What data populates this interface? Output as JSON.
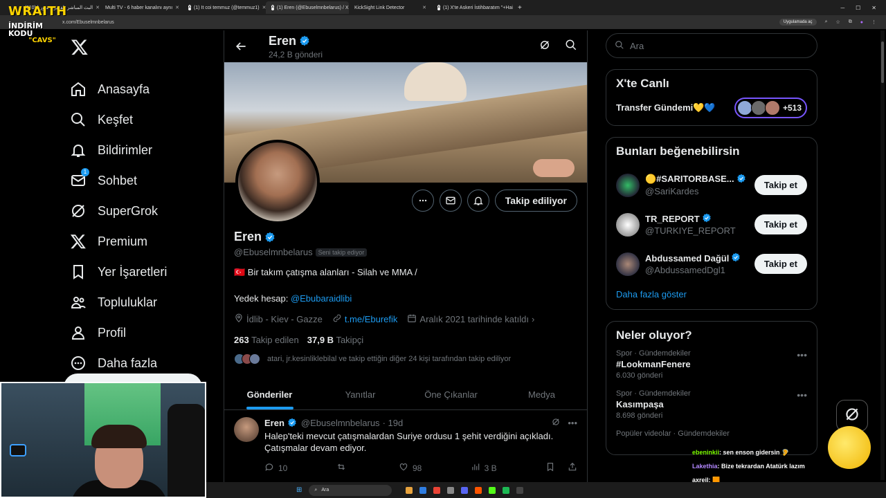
{
  "browser": {
    "tabs": [
      {
        "title": "(110) البث المباشر تلفزيون سوريا",
        "active": false
      },
      {
        "title": "Multi TV - 6 haber kanalını aynı",
        "active": false
      },
      {
        "title": "(1) It coi temmuz (@temmuz1)",
        "active": false
      },
      {
        "title": "(1) Eren (@Ebuselmnbelarus) / X",
        "active": true
      },
      {
        "title": "KickSight Link Detector",
        "active": false
      },
      {
        "title": "(1) X'te Askeri İstihbaratım \"+Hai",
        "active": false
      }
    ],
    "url": "x.com/Ebuselmnbelarus",
    "install_label": "Uygulamada aç"
  },
  "stream_overlay": {
    "line1": "WRAITH",
    "line2": "İNDİRİM KODU",
    "line3": "\"CAVS\""
  },
  "nav": {
    "items": [
      {
        "label": "Anasayfa",
        "icon": "home-icon"
      },
      {
        "label": "Keşfet",
        "icon": "search-icon"
      },
      {
        "label": "Bildirimler",
        "icon": "bell-icon"
      },
      {
        "label": "Sohbet",
        "icon": "mail-icon",
        "badge": "1"
      },
      {
        "label": "SuperGrok",
        "icon": "grok-icon"
      },
      {
        "label": "Premium",
        "icon": "x-icon"
      },
      {
        "label": "Yer İşaretleri",
        "icon": "bookmark-icon"
      },
      {
        "label": "Topluluklar",
        "icon": "communities-icon"
      },
      {
        "label": "Profil",
        "icon": "profile-icon"
      },
      {
        "label": "Daha fazla",
        "icon": "more-icon"
      }
    ]
  },
  "profile": {
    "header_name": "Eren",
    "header_count": "24,2 B gönderi",
    "name": "Eren",
    "handle": "@Ebuselmnbelarus",
    "follows_you": "Seni takip ediyor",
    "bio_line1": "🇹🇷 Bir takım çatışma alanları - Silah ve MMA /",
    "bio_line2_prefix": "Yedek hesap: ",
    "bio_line2_link": "@Ebubaraidlibi",
    "location": "İdlib - Kiev - Gazze",
    "website": "t.me/Eburefik",
    "joined": "Aralık 2021 tarihinde katıldı",
    "following_count": "263",
    "following_label": "Takip edilen",
    "followers_count": "37,9 B",
    "followers_label": "Takipçi",
    "known_followers": "atari, jr.kesinliklebilal ve takip ettiğin diğer 24 kişi tarafından takip ediliyor",
    "follow_button": "Takip ediliyor",
    "tabs": [
      "Gönderiler",
      "Yanıtlar",
      "Öne Çıkanlar",
      "Medya"
    ]
  },
  "tweet": {
    "name": "Eren",
    "handle": "@Ebuselmnbelarus",
    "time": "· 19d",
    "text": "Halep'teki mevcut çatışmalardan Suriye ordusu 1 şehit verdiğini açıkladı. Çatışmalar devam ediyor.",
    "replies": "10",
    "retweets": "",
    "likes": "98",
    "views": "3 B"
  },
  "right": {
    "search_placeholder": "Ara",
    "live_title": "X'te Canlı",
    "live_topic": "Transfer Gündemi💛💙",
    "live_count": "+513",
    "suggest_title": "Bunları beğenebilirsin",
    "suggestions": [
      {
        "name": "🟡#SARITORBASE...",
        "handle": "@SariKardes",
        "button": "Takip et"
      },
      {
        "name": "TR_REPORT",
        "handle": "@TURKIYE_REPORT",
        "button": "Takip et"
      },
      {
        "name": "Abdussamed Dağül",
        "handle": "@AbdussamedDgl1",
        "button": "Takip et"
      }
    ],
    "show_more": "Daha fazla göster",
    "trends_title": "Neler oluyor?",
    "trends": [
      {
        "category": "Spor · Gündemdekiler",
        "name": "#LookmanFenere",
        "count": "6.030 gönderi"
      },
      {
        "category": "Spor · Gündemdekiler",
        "name": "Kasımpaşa",
        "count": "8.698 gönderi"
      },
      {
        "category": "Popüler videolar · Gündemdekiler",
        "name": "",
        "count": ""
      }
    ]
  },
  "chat": [
    {
      "user": "ebeninkii",
      "msg": ": sen enson gidersin 🦻"
    },
    {
      "user": "Lakethia",
      "msg": ": Bize tekrardan Atatürk lazım"
    },
    {
      "user": "axreil",
      "msg": ": 🟧"
    }
  ],
  "taskbar": {
    "search": "Ara"
  }
}
